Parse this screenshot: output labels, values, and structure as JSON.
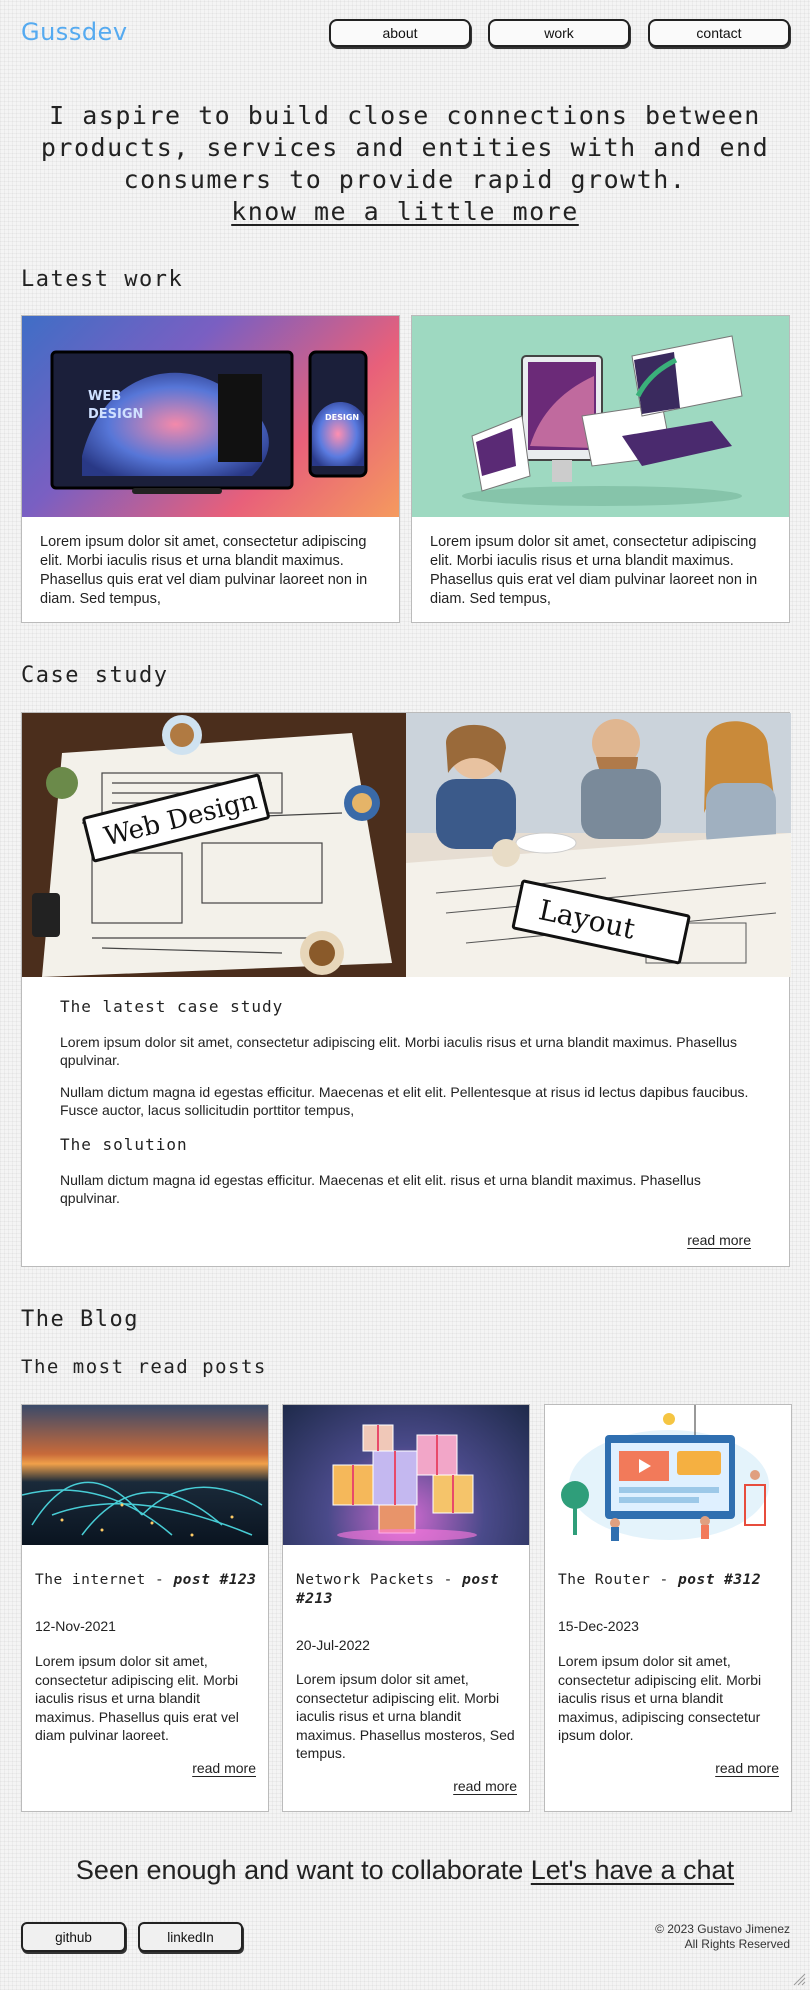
{
  "header": {
    "logo": "Gussdev",
    "nav": [
      {
        "label": "about"
      },
      {
        "label": "work"
      },
      {
        "label": "contact"
      }
    ]
  },
  "hero": {
    "statement": "I aspire to build close connections between products, services and entities with and end consumers to provide rapid growth.",
    "link": "know me a little more"
  },
  "latest_work": {
    "title": "Latest work",
    "cards": [
      {
        "image": "web-design-mockup-image",
        "text": "Lorem ipsum dolor sit amet, consectetur adipiscing elit. Morbi iaculis risus et urna blandit maximus. Phasellus quis erat vel diam pulvinar laoreet non in diam. Sed tempus,",
        "image_words": [
          "WEB",
          "DESIGN"
        ]
      },
      {
        "image": "responsive-devices-mockup-image",
        "text": "Lorem ipsum dolor sit amet, consectetur adipiscing elit. Morbi iaculis risus et urna blandit maximus. Phasellus quis erat vel diam pulvinar laoreet non in diam. Sed tempus,"
      }
    ]
  },
  "case_study": {
    "title": "Case study",
    "images": [
      {
        "image": "web-design-sketch-image",
        "sign": "Web Design"
      },
      {
        "image": "team-layout-meeting-image",
        "sign": "Layout"
      }
    ],
    "heading1": "The latest case study",
    "para1": "Lorem ipsum dolor sit amet, consectetur adipiscing elit. Morbi iaculis risus et urna blandit maximus. Phasellus qpulvinar.",
    "para2": "Nullam dictum magna id egestas efficitur. Maecenas et elit elit. Pellentesque at risus id lectus dapibus faucibus. Fusce auctor, lacus sollicitudin porttitor tempus,",
    "heading2": "The solution",
    "para3": "Nullam dictum magna id egestas efficitur. Maecenas et elit elit. risus et urna blandit maximus. Phasellus qpulvinar.",
    "read_more": "read more"
  },
  "blog": {
    "title": "The Blog",
    "subtitle": "The most read posts",
    "posts": [
      {
        "image": "network-city-image",
        "title": "The internet - ",
        "post": "post #123",
        "date": "12-Nov-2021",
        "text": "Lorem ipsum dolor sit amet, consectetur adipiscing elit. Morbi iaculis risus et urna blandit maximus. Phasellus quis erat vel diam pulvinar laoreet.",
        "read_more": "read more"
      },
      {
        "image": "gift-boxes-image",
        "title": "Network Packets - ",
        "post": "post #213",
        "date": "20-Jul-2022",
        "text": "Lorem ipsum dolor sit amet, consectetur adipiscing elit. Morbi iaculis risus et urna blandit maximus. Phasellus mosteros, Sed tempus.",
        "read_more": "read more"
      },
      {
        "image": "router-illustration-image",
        "title": "The Router - ",
        "post": "post #312",
        "date": "15-Dec-2023",
        "text": "Lorem ipsum dolor sit amet, consectetur adipiscing elit. Morbi iaculis risus et urna blandit maximus, adipiscing consectetur ipsum dolor.",
        "read_more": "read more"
      }
    ]
  },
  "footer": {
    "cta_text": "Seen enough and want to collaborate ",
    "cta_link": "Let's have a chat",
    "buttons": [
      {
        "label": "github"
      },
      {
        "label": "linkedIn"
      }
    ],
    "copyright_line1": "© 2023 Gustavo Jimenez",
    "copyright_line2": "All Rights Reserved"
  },
  "colors": {
    "accent": "#55aaf0",
    "background": "#f4f4f4",
    "text": "#222222"
  }
}
